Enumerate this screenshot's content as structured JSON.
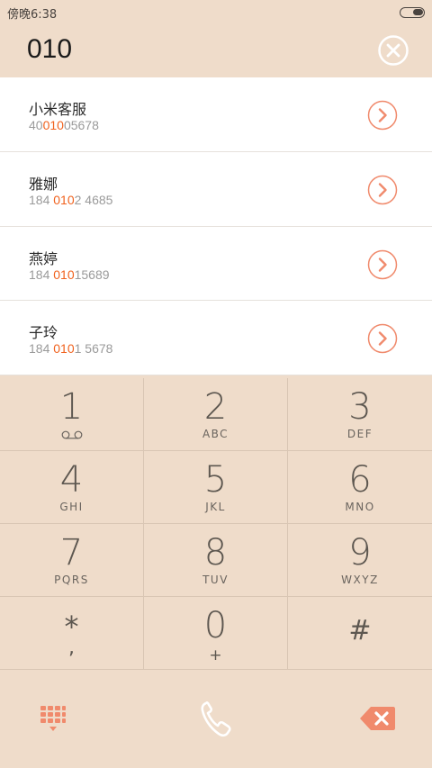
{
  "status_bar": {
    "time": "傍晚6:38"
  },
  "dialer": {
    "input_value": "010"
  },
  "contacts": [
    {
      "name": "小米客服",
      "number_pre": "40",
      "number_hl": "010",
      "number_post": "05678"
    },
    {
      "name": "雅娜",
      "number_pre": "184 ",
      "number_hl": "010",
      "number_post": "2 4685"
    },
    {
      "name": "燕婷",
      "number_pre": "184 ",
      "number_hl": "010",
      "number_post": "15689"
    },
    {
      "name": "子玲",
      "number_pre": "184 ",
      "number_hl": "010",
      "number_post": "1 5678"
    }
  ],
  "keypad": {
    "keys": [
      {
        "digit": "1",
        "letters": ""
      },
      {
        "digit": "2",
        "letters": "ABC"
      },
      {
        "digit": "3",
        "letters": "DEF"
      },
      {
        "digit": "4",
        "letters": "GHI"
      },
      {
        "digit": "5",
        "letters": "JKL"
      },
      {
        "digit": "6",
        "letters": "MNO"
      },
      {
        "digit": "7",
        "letters": "PQRS"
      },
      {
        "digit": "8",
        "letters": "TUV"
      },
      {
        "digit": "9",
        "letters": "WXYZ"
      }
    ],
    "star": "*",
    "star_sub": ",",
    "zero": "0",
    "zero_sub": "+",
    "hash": "#"
  },
  "colors": {
    "background": "#efdcca",
    "accent": "#f0621e",
    "icon_accent": "#f08a6c"
  },
  "icons": {
    "clear": "close-circle-icon",
    "detail": "chevron-right-circle-icon",
    "voicemail": "voicemail-icon",
    "keypad_toggle": "keypad-grid-icon",
    "call": "phone-icon",
    "backspace": "backspace-icon"
  }
}
